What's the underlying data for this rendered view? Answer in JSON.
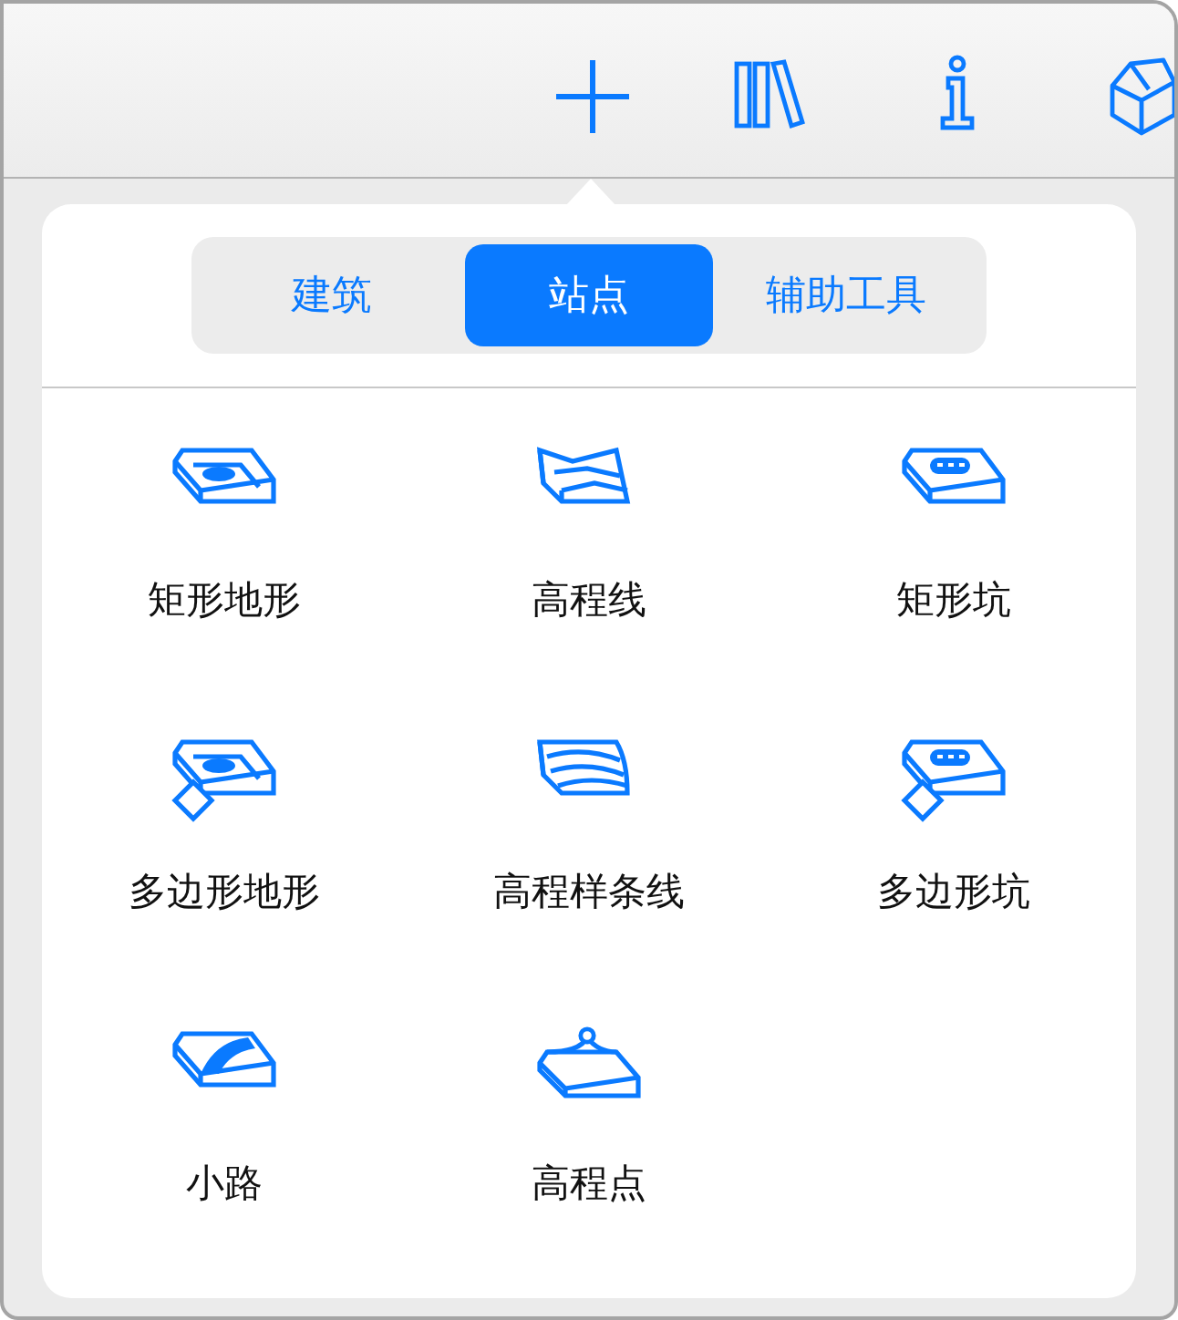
{
  "toolbar": {
    "buttons": [
      {
        "kind": "add"
      },
      {
        "kind": "library"
      },
      {
        "kind": "info"
      },
      {
        "kind": "model"
      }
    ]
  },
  "popover": {
    "tabs": [
      {
        "label": "建筑",
        "selected": false
      },
      {
        "label": "站点",
        "selected": true
      },
      {
        "label": "辅助工具",
        "selected": false
      }
    ],
    "items": [
      {
        "label": "矩形地形",
        "kind": "rect-terrain"
      },
      {
        "label": "高程线",
        "kind": "contour"
      },
      {
        "label": "矩形坑",
        "kind": "rect-pit"
      },
      {
        "label": "多边形地形",
        "kind": "poly-terrain"
      },
      {
        "label": "高程样条线",
        "kind": "spline"
      },
      {
        "label": "多边形坑",
        "kind": "poly-pit"
      },
      {
        "label": "小路",
        "kind": "path"
      },
      {
        "label": "高程点",
        "kind": "point"
      }
    ]
  }
}
